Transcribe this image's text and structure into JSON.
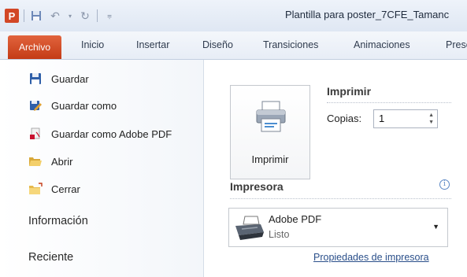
{
  "window": {
    "title": "Plantilla para poster_7CFE_Tamanc",
    "app_logo": "P"
  },
  "tabs": [
    "Archivo",
    "Inicio",
    "Insertar",
    "Diseño",
    "Transiciones",
    "Animaciones",
    "Prese"
  ],
  "backstage_menu": {
    "items": [
      {
        "label": "Guardar",
        "icon": "save-icon"
      },
      {
        "label": "Guardar como",
        "icon": "save-as-icon"
      },
      {
        "label": "Guardar como Adobe PDF",
        "icon": "pdf-icon"
      },
      {
        "label": "Abrir",
        "icon": "open-folder-icon"
      },
      {
        "label": "Cerrar",
        "icon": "close-folder-icon"
      }
    ],
    "sections": [
      "Información",
      "Reciente"
    ]
  },
  "print_panel": {
    "print_button_label": "Imprimir",
    "section_title": "Imprimir",
    "copies_label": "Copias:",
    "copies_value": "1",
    "printer_section_title": "Impresora",
    "printer_name": "Adobe PDF",
    "printer_status": "Listo",
    "printer_properties_link": "Propiedades de impresora"
  },
  "colors": {
    "file_tab": "#d24726",
    "link": "#2a4f8a"
  }
}
